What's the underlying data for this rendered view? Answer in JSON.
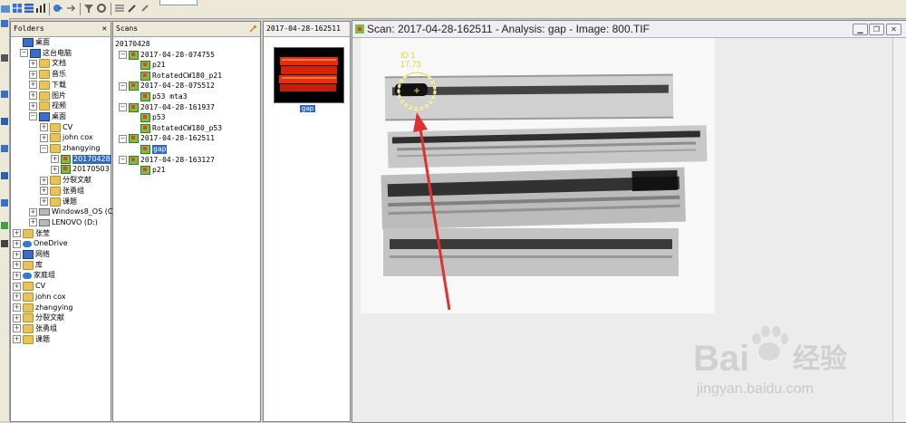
{
  "panels": {
    "folders_title": "Folders",
    "folders_close": "✕",
    "scans_title": "Scans",
    "thumb_title": "2017-04-28-162511",
    "thumb_label": "gap"
  },
  "folders": [
    {
      "label": "桌面",
      "level": 0,
      "icon": "desktop"
    },
    {
      "label": "这台电脑",
      "level": 1,
      "icon": "pc"
    },
    {
      "label": "文档",
      "level": 2,
      "icon": "folder"
    },
    {
      "label": "音乐",
      "level": 2,
      "icon": "folder"
    },
    {
      "label": "下载",
      "level": 2,
      "icon": "folder"
    },
    {
      "label": "图片",
      "level": 2,
      "icon": "folder"
    },
    {
      "label": "视频",
      "level": 2,
      "icon": "folder"
    },
    {
      "label": "桌面",
      "level": 2,
      "icon": "desktop"
    },
    {
      "label": "CV",
      "level": 3,
      "icon": "folder"
    },
    {
      "label": "john cox",
      "level": 3,
      "icon": "folder"
    },
    {
      "label": "zhangying",
      "level": 3,
      "icon": "folder"
    },
    {
      "label": "20170428",
      "level": 4,
      "icon": "scan",
      "selected": true
    },
    {
      "label": "20170503",
      "level": 4,
      "icon": "scan"
    },
    {
      "label": "分裂文献",
      "level": 3,
      "icon": "folder"
    },
    {
      "label": "张勇组",
      "level": 3,
      "icon": "folder"
    },
    {
      "label": "课题",
      "level": 3,
      "icon": "folder"
    },
    {
      "label": "Windows8_OS (C:",
      "level": 2,
      "icon": "drive"
    },
    {
      "label": "LENOVO (D:)",
      "level": 2,
      "icon": "drive"
    },
    {
      "label": "张莹",
      "level": 0,
      "icon": "folder"
    },
    {
      "label": "OneDrive",
      "level": 0,
      "icon": "cloud"
    },
    {
      "label": "网络",
      "level": 0,
      "icon": "pc"
    },
    {
      "label": "库",
      "level": 0,
      "icon": "folder"
    },
    {
      "label": "家庭组",
      "level": 0,
      "icon": "cloud"
    },
    {
      "label": "CV",
      "level": 0,
      "icon": "folder"
    },
    {
      "label": "john cox",
      "level": 0,
      "icon": "folder"
    },
    {
      "label": "zhangying",
      "level": 0,
      "icon": "folder"
    },
    {
      "label": "分裂文献",
      "level": 0,
      "icon": "folder"
    },
    {
      "label": "张勇组",
      "level": 0,
      "icon": "folder"
    },
    {
      "label": "课题",
      "level": 0,
      "icon": "folder"
    }
  ],
  "scans": [
    {
      "label": "20170428",
      "level": 0
    },
    {
      "label": "2017-04-28-074755",
      "level": 1
    },
    {
      "label": "p21",
      "level": 2
    },
    {
      "label": "RotatedCW180_p21",
      "level": 2
    },
    {
      "label": "2017-04-28-075512",
      "level": 1
    },
    {
      "label": "p53 mta3",
      "level": 2
    },
    {
      "label": "2017-04-28-161937",
      "level": 1
    },
    {
      "label": "p53",
      "level": 2
    },
    {
      "label": "RotatedCW180_p53",
      "level": 2
    },
    {
      "label": "2017-04-28-162511",
      "level": 1
    },
    {
      "label": "gap",
      "level": 2,
      "selected": true
    },
    {
      "label": "2017-04-28-163127",
      "level": 1
    },
    {
      "label": "p21",
      "level": 2
    }
  ],
  "image_window": {
    "title": "Scan: 2017-04-28-162511 - Analysis: gap - Image: 800.TIF",
    "roi_id": "ID 1",
    "roi_value": "17.73"
  },
  "watermark": {
    "brand": "Bai",
    "brand2": "经验",
    "url": "jingyan.baidu.com"
  },
  "colors": {
    "accent": "#3169c6",
    "roi": "#e8d020",
    "arrow": "#e03030",
    "gel_red": "#e82a10"
  }
}
